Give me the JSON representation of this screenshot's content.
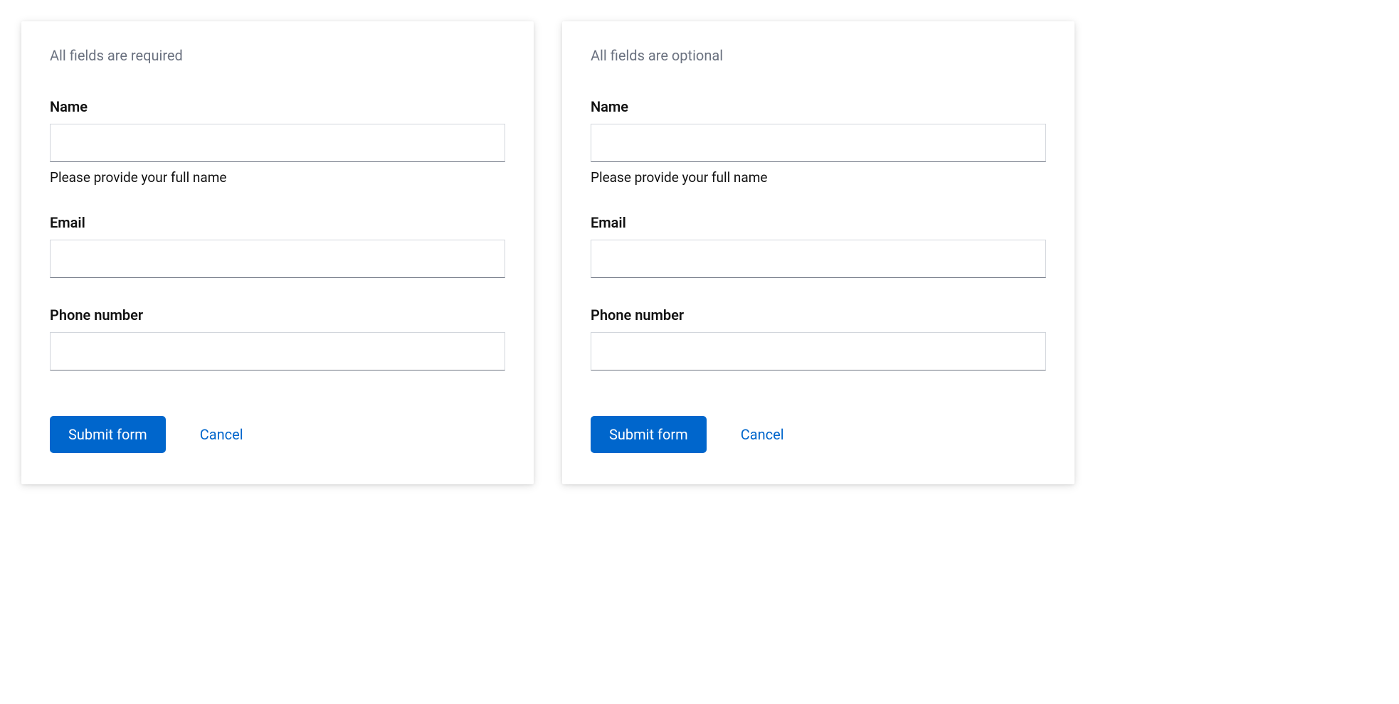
{
  "forms": [
    {
      "caption": "All fields are required",
      "fields": {
        "name": {
          "label": "Name",
          "value": "",
          "helper": "Please provide your full name"
        },
        "email": {
          "label": "Email",
          "value": ""
        },
        "phone": {
          "label": "Phone number",
          "value": ""
        }
      },
      "actions": {
        "submit": "Submit form",
        "cancel": "Cancel"
      }
    },
    {
      "caption": "All fields are optional",
      "fields": {
        "name": {
          "label": "Name",
          "value": "",
          "helper": "Please provide your full name"
        },
        "email": {
          "label": "Email",
          "value": ""
        },
        "phone": {
          "label": "Phone number",
          "value": ""
        }
      },
      "actions": {
        "submit": "Submit form",
        "cancel": "Cancel"
      }
    }
  ],
  "colors": {
    "primary": "#0066cc",
    "caption": "#6b7280",
    "text": "#111111"
  }
}
